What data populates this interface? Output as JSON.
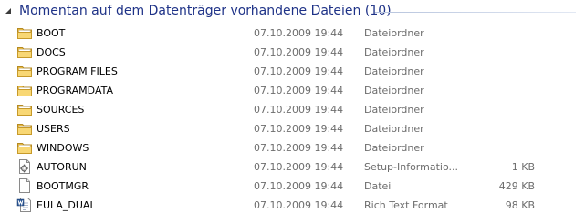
{
  "group": {
    "title": "Momentan auf dem Datenträger vorhandene Dateien (10)",
    "accent_color": "#1e3287"
  },
  "files": [
    {
      "name": "BOOT",
      "date": "07.10.2009 19:44",
      "type": "Dateiordner",
      "size": "",
      "icon": "folder-icon"
    },
    {
      "name": "DOCS",
      "date": "07.10.2009 19:44",
      "type": "Dateiordner",
      "size": "",
      "icon": "folder-icon"
    },
    {
      "name": "PROGRAM FILES",
      "date": "07.10.2009 19:44",
      "type": "Dateiordner",
      "size": "",
      "icon": "folder-icon"
    },
    {
      "name": "PROGRAMDATA",
      "date": "07.10.2009 19:44",
      "type": "Dateiordner",
      "size": "",
      "icon": "folder-icon"
    },
    {
      "name": "SOURCES",
      "date": "07.10.2009 19:44",
      "type": "Dateiordner",
      "size": "",
      "icon": "folder-icon"
    },
    {
      "name": "USERS",
      "date": "07.10.2009 19:44",
      "type": "Dateiordner",
      "size": "",
      "icon": "folder-icon"
    },
    {
      "name": "WINDOWS",
      "date": "07.10.2009 19:44",
      "type": "Dateiordner",
      "size": "",
      "icon": "folder-icon"
    },
    {
      "name": "AUTORUN",
      "date": "07.10.2009 19:44",
      "type": "Setup-Informatio...",
      "size": "1 KB",
      "icon": "setup-information-file-icon"
    },
    {
      "name": "BOOTMGR",
      "date": "07.10.2009 19:44",
      "type": "Datei",
      "size": "429 KB",
      "icon": "generic-file-icon"
    },
    {
      "name": "EULA_DUAL",
      "date": "07.10.2009 19:44",
      "type": "Rich Text Format",
      "size": "98 KB",
      "icon": "rich-text-document-icon"
    }
  ]
}
